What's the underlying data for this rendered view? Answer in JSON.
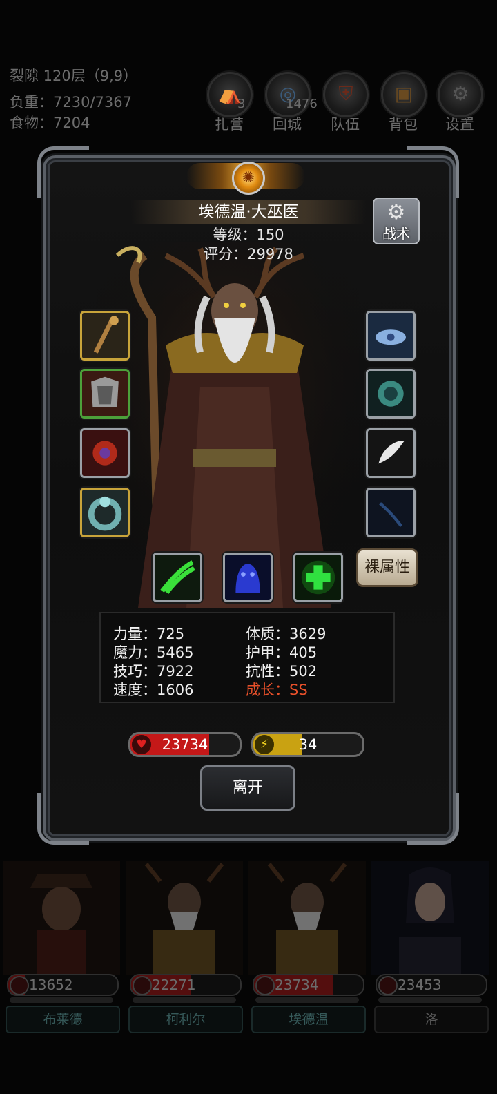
{
  "hud": {
    "location": "裂隙 120层（9,9）",
    "load": "负重：7230/7367",
    "food": "食物：7204",
    "buttons": [
      {
        "label": "扎营",
        "icon": "camp-icon",
        "badge": "3"
      },
      {
        "label": "回城",
        "icon": "portal-icon",
        "badge": "1476"
      },
      {
        "label": "队伍",
        "icon": "team-icon",
        "badge": ""
      },
      {
        "label": "背包",
        "icon": "bag-icon",
        "badge": ""
      },
      {
        "label": "设置",
        "icon": "gear-icon",
        "badge": ""
      }
    ]
  },
  "hero": {
    "name": "埃德温·大巫医",
    "level": "等级：150",
    "score": "评分：29978",
    "tactic_label": "战术",
    "naked_attr_label": "裸属性"
  },
  "equipment": {
    "left": [
      "staff-icon",
      "armor-icon",
      "amulet-icon",
      "ring-icon"
    ],
    "right": [
      "frost-crown-icon",
      "orb-icon",
      "wing-icon",
      "shadow-icon"
    ],
    "skills": [
      "green-claw-icon",
      "blue-spirit-icon",
      "heal-cross-icon"
    ]
  },
  "stats": {
    "left": [
      "力量：725",
      "魔力：5465",
      "技巧：7922",
      "速度：1606"
    ],
    "right": [
      "体质：3629",
      "护甲：405",
      "抗性：502",
      "成长：SS"
    ]
  },
  "bars": {
    "hp": "23734",
    "mp": "34",
    "hp_fraction": 0.72,
    "mp_fraction": 0.45,
    "hp_color": "#c41818",
    "mp_color": "#c9a212"
  },
  "leave_label": "离开",
  "party": [
    {
      "hp": "13652",
      "name": "布莱德",
      "hp_fraction": 0.15
    },
    {
      "hp": "22271",
      "name": "柯利尔",
      "hp_fraction": 0.55
    },
    {
      "hp": "23734",
      "name": "埃德温",
      "hp_fraction": 0.72
    },
    {
      "hp": "23453",
      "name": "洛",
      "hp_fraction": 0.0
    }
  ]
}
